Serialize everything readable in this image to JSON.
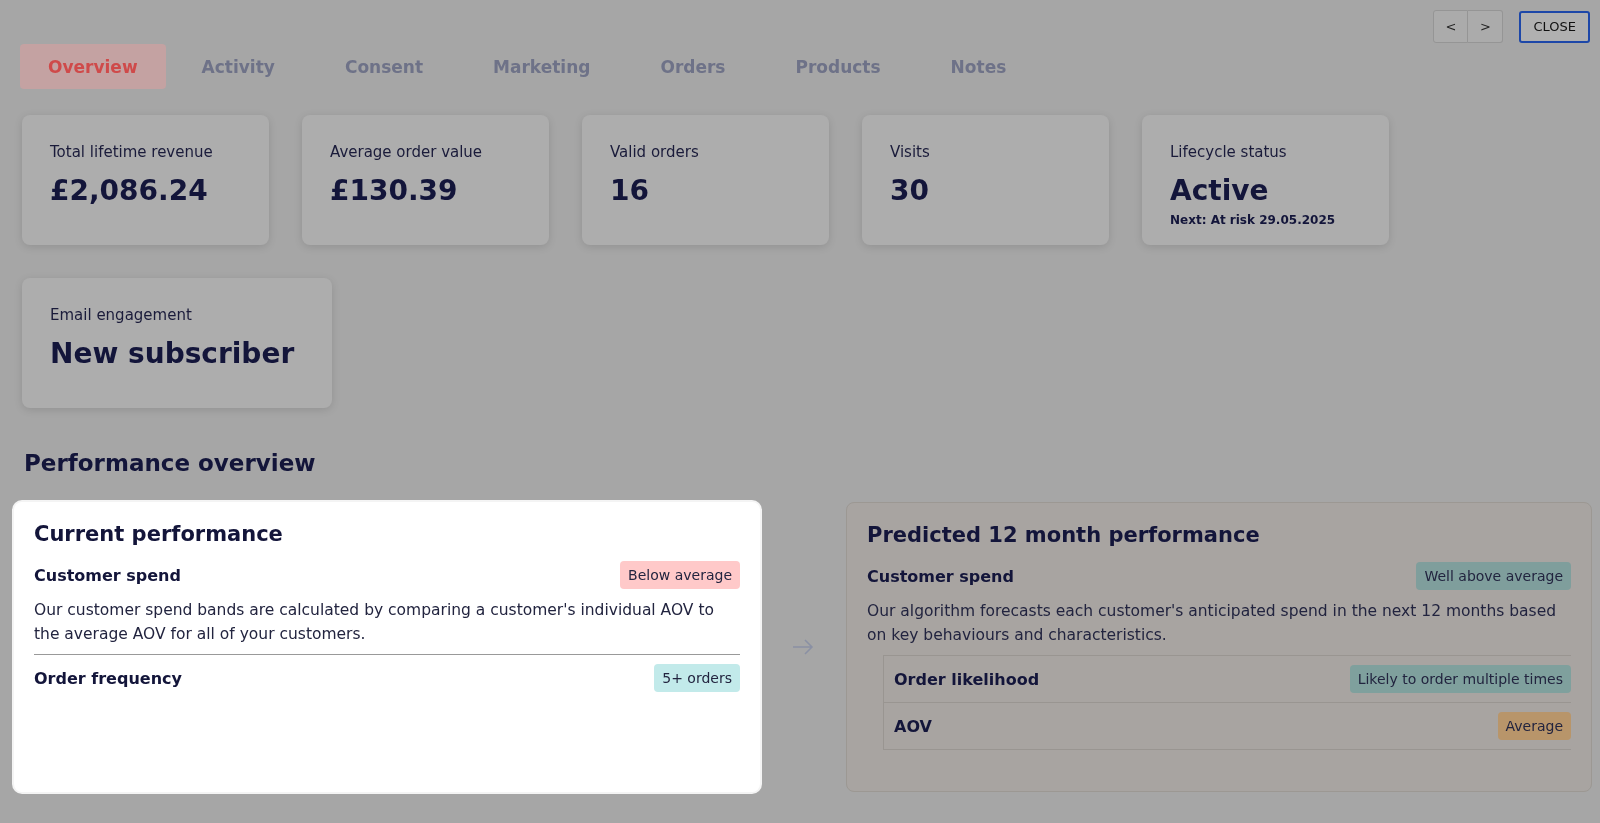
{
  "nav": {
    "prev": "<",
    "next": ">",
    "close": "CLOSE"
  },
  "tabs": [
    {
      "label": "Overview",
      "selected": true
    },
    {
      "label": "Activity",
      "selected": false
    },
    {
      "label": "Consent",
      "selected": false
    },
    {
      "label": "Marketing",
      "selected": false
    },
    {
      "label": "Orders",
      "selected": false
    },
    {
      "label": "Products",
      "selected": false
    },
    {
      "label": "Notes",
      "selected": false
    }
  ],
  "stats": [
    {
      "label": "Total lifetime revenue",
      "value": "£2,086.24"
    },
    {
      "label": "Average order value",
      "value": "£130.39"
    },
    {
      "label": "Valid orders",
      "value": "16"
    },
    {
      "label": "Visits",
      "value": "30"
    },
    {
      "label": "Lifecycle status",
      "value": "Active",
      "note": "Next: At risk 29.05.2025"
    },
    {
      "label": "Email engagement",
      "value": "New subscriber"
    }
  ],
  "performance_overview": {
    "title": "Performance overview",
    "panels": [
      {
        "title": "Current performance",
        "highlighted": true,
        "sections": [
          {
            "kind": "main",
            "label": "Customer spend",
            "badge": "Below average",
            "color": "#ffc9c9",
            "description": "Our customer spend bands are calculated by comparing a customer's individual AOV to the average AOV for all of your customers."
          },
          {
            "kind": "main",
            "label": "Order frequency",
            "badge": "5+ orders",
            "color": "#c2eaea"
          }
        ]
      },
      {
        "title": "Predicted 12 month performance",
        "highlighted": false,
        "sections": [
          {
            "kind": "main",
            "label": "Customer spend",
            "badge": "Well above average",
            "color": "#7f9e9c",
            "description": "Our algorithm forecasts each customer's anticipated spend in the next 12 months based on key behaviours and characteristics."
          },
          {
            "kind": "sub",
            "label": "Order likelihood",
            "badge": "Likely to order multiple times",
            "color": "#7fa09d"
          },
          {
            "kind": "sub",
            "label": "AOV",
            "badge": "Average",
            "color": "#b8956a"
          }
        ]
      }
    ]
  }
}
